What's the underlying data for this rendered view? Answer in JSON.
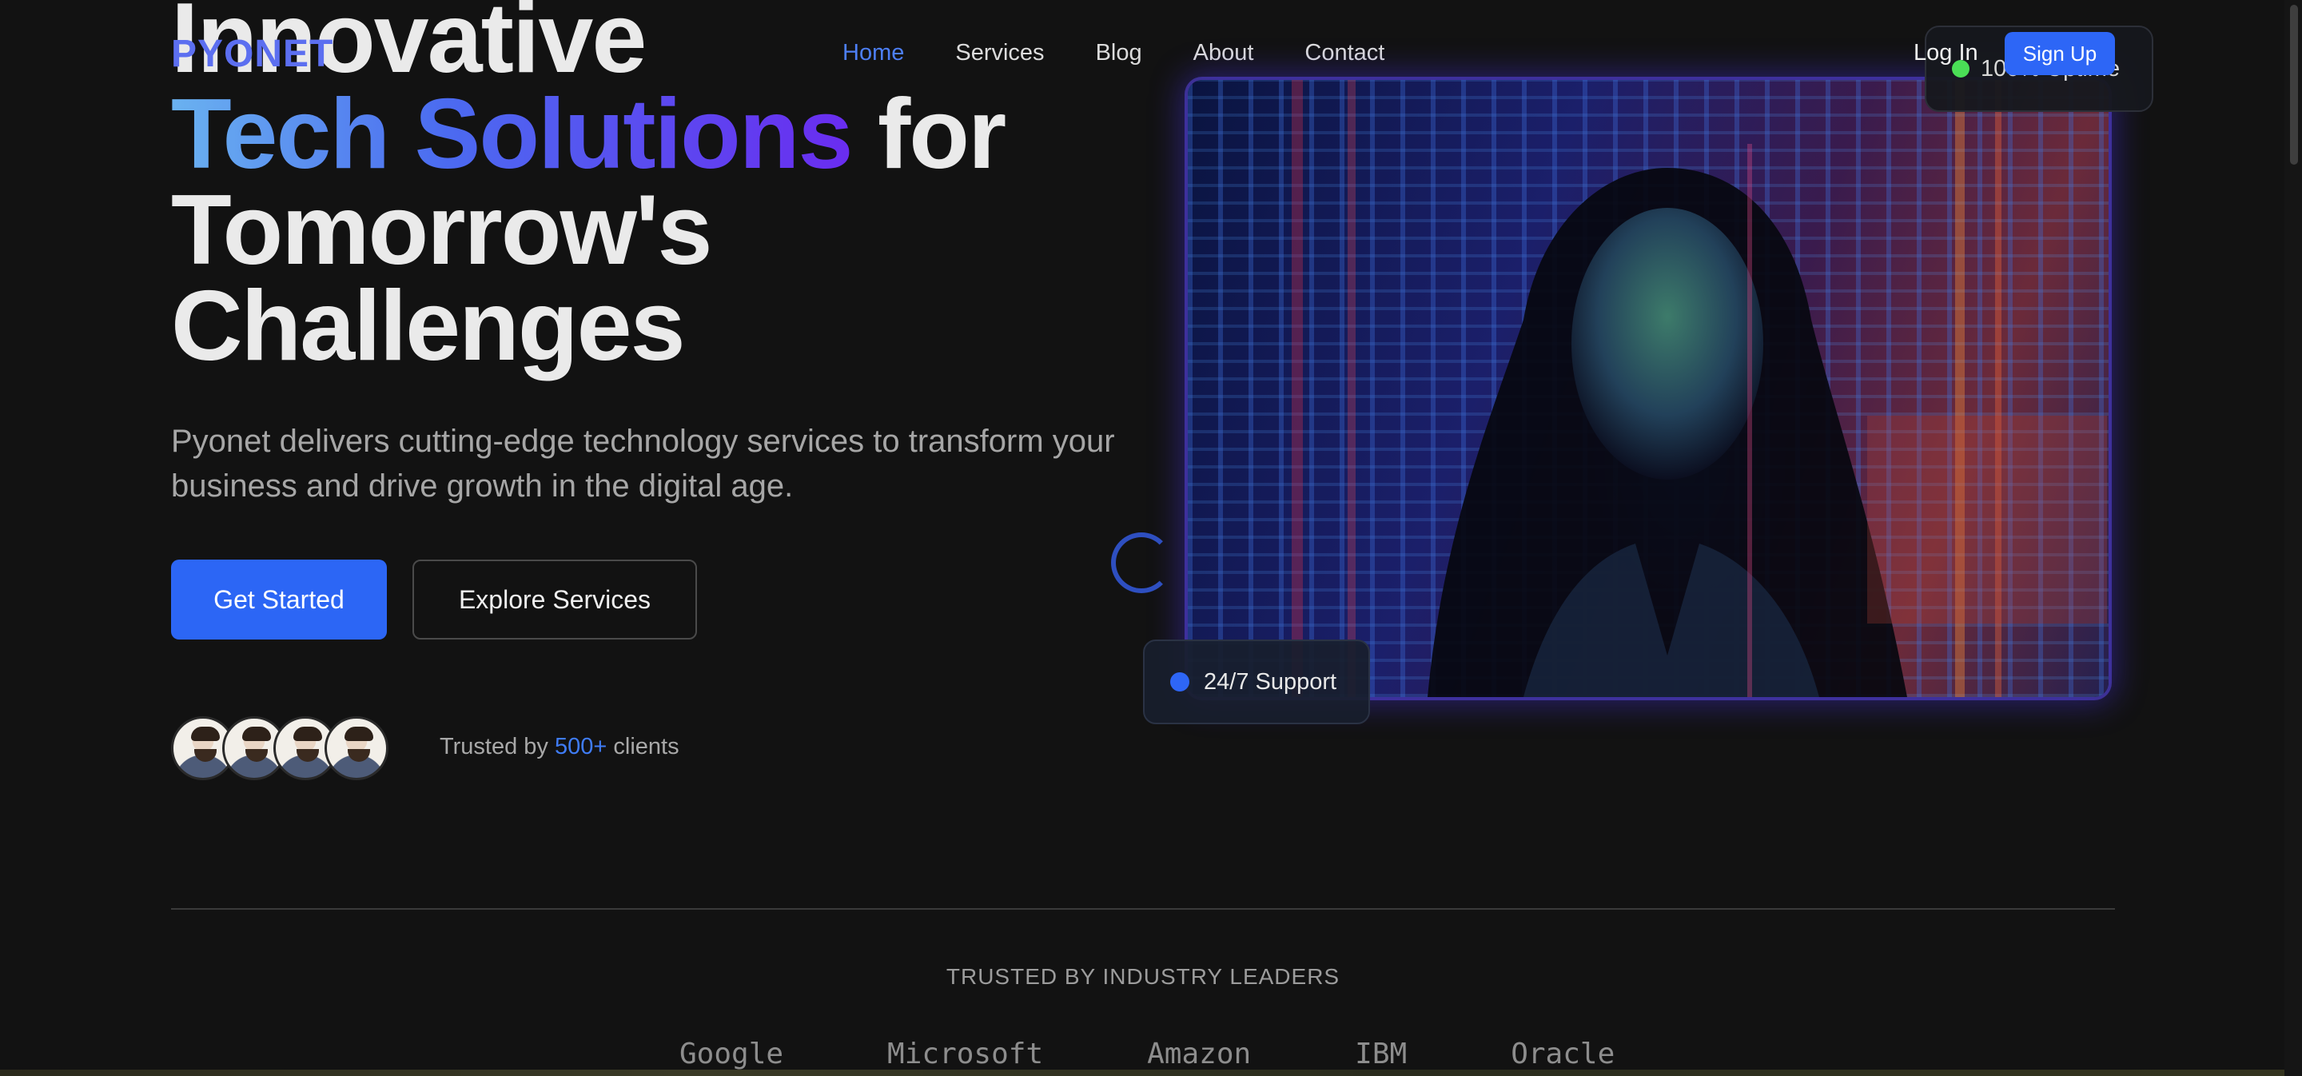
{
  "nav": {
    "logo": "PYONET",
    "links": [
      {
        "label": "Home",
        "active": true
      },
      {
        "label": "Services",
        "active": false
      },
      {
        "label": "Blog",
        "active": false
      },
      {
        "label": "About",
        "active": false
      },
      {
        "label": "Contact",
        "active": false
      }
    ],
    "login": "Log In",
    "signup": "Sign Up"
  },
  "hero": {
    "title_line1": "Innovative",
    "title_grad": "Tech Solutions",
    "title_line2_rest": " for",
    "title_line3": "Tomorrow's",
    "title_line4": "Challenges",
    "subtitle": "Pyonet delivers cutting-edge technology services to transform your business and drive growth in the digital age.",
    "primary_cta": "Get Started",
    "secondary_cta": "Explore Services",
    "trusted_prefix": "Trusted by ",
    "trusted_count": "500+",
    "trusted_suffix": " clients"
  },
  "badges": {
    "support": "24/7 Support",
    "uptime": "100% Uptime"
  },
  "partners": {
    "label": "TRUSTED BY INDUSTRY LEADERS",
    "logos": [
      "Google",
      "Microsoft",
      "Amazon",
      "IBM",
      "Oracle"
    ]
  },
  "colors": {
    "accent": "#2c66f5",
    "background": "#121212",
    "uptime_dot": "#4ade56"
  }
}
